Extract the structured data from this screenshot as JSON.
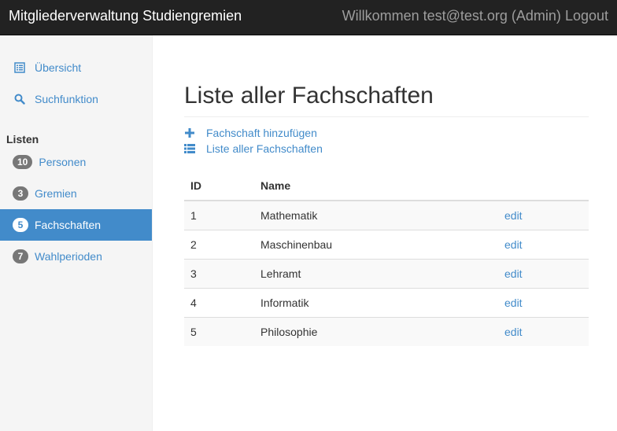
{
  "navbar": {
    "brand": "Mitgliederverwaltung Studiengremien",
    "welcome": "Willkommen test@test.org (Admin)",
    "logout": "Logout"
  },
  "sidebar": {
    "overview": "Übersicht",
    "search": "Suchfunktion",
    "lists_heading": "Listen",
    "lists": [
      {
        "count": "10",
        "label": "Personen"
      },
      {
        "count": "3",
        "label": "Gremien"
      },
      {
        "count": "5",
        "label": "Fachschaften",
        "active": true
      },
      {
        "count": "7",
        "label": "Wahlperioden"
      }
    ]
  },
  "main": {
    "title": "Liste aller Fachschaften",
    "actions": {
      "add": "Fachschaft hinzufügen",
      "list": "Liste aller Fachschaften"
    },
    "table": {
      "columns": [
        "ID",
        "Name",
        ""
      ],
      "rows": [
        {
          "id": "1",
          "name": "Mathematik",
          "action": "edit"
        },
        {
          "id": "2",
          "name": "Maschinenbau",
          "action": "edit"
        },
        {
          "id": "3",
          "name": "Lehramt",
          "action": "edit"
        },
        {
          "id": "4",
          "name": "Informatik",
          "action": "edit"
        },
        {
          "id": "5",
          "name": "Philosophie",
          "action": "edit"
        }
      ]
    }
  },
  "colors": {
    "navbar_bg": "#222222",
    "link": "#428bca",
    "active_bg": "#428bca",
    "badge_bg": "#777777",
    "sidebar_bg": "#f5f5f5"
  },
  "icons": {
    "overview": "list-alt-icon",
    "search": "search-icon",
    "add": "plus-icon",
    "list": "th-list-icon"
  }
}
